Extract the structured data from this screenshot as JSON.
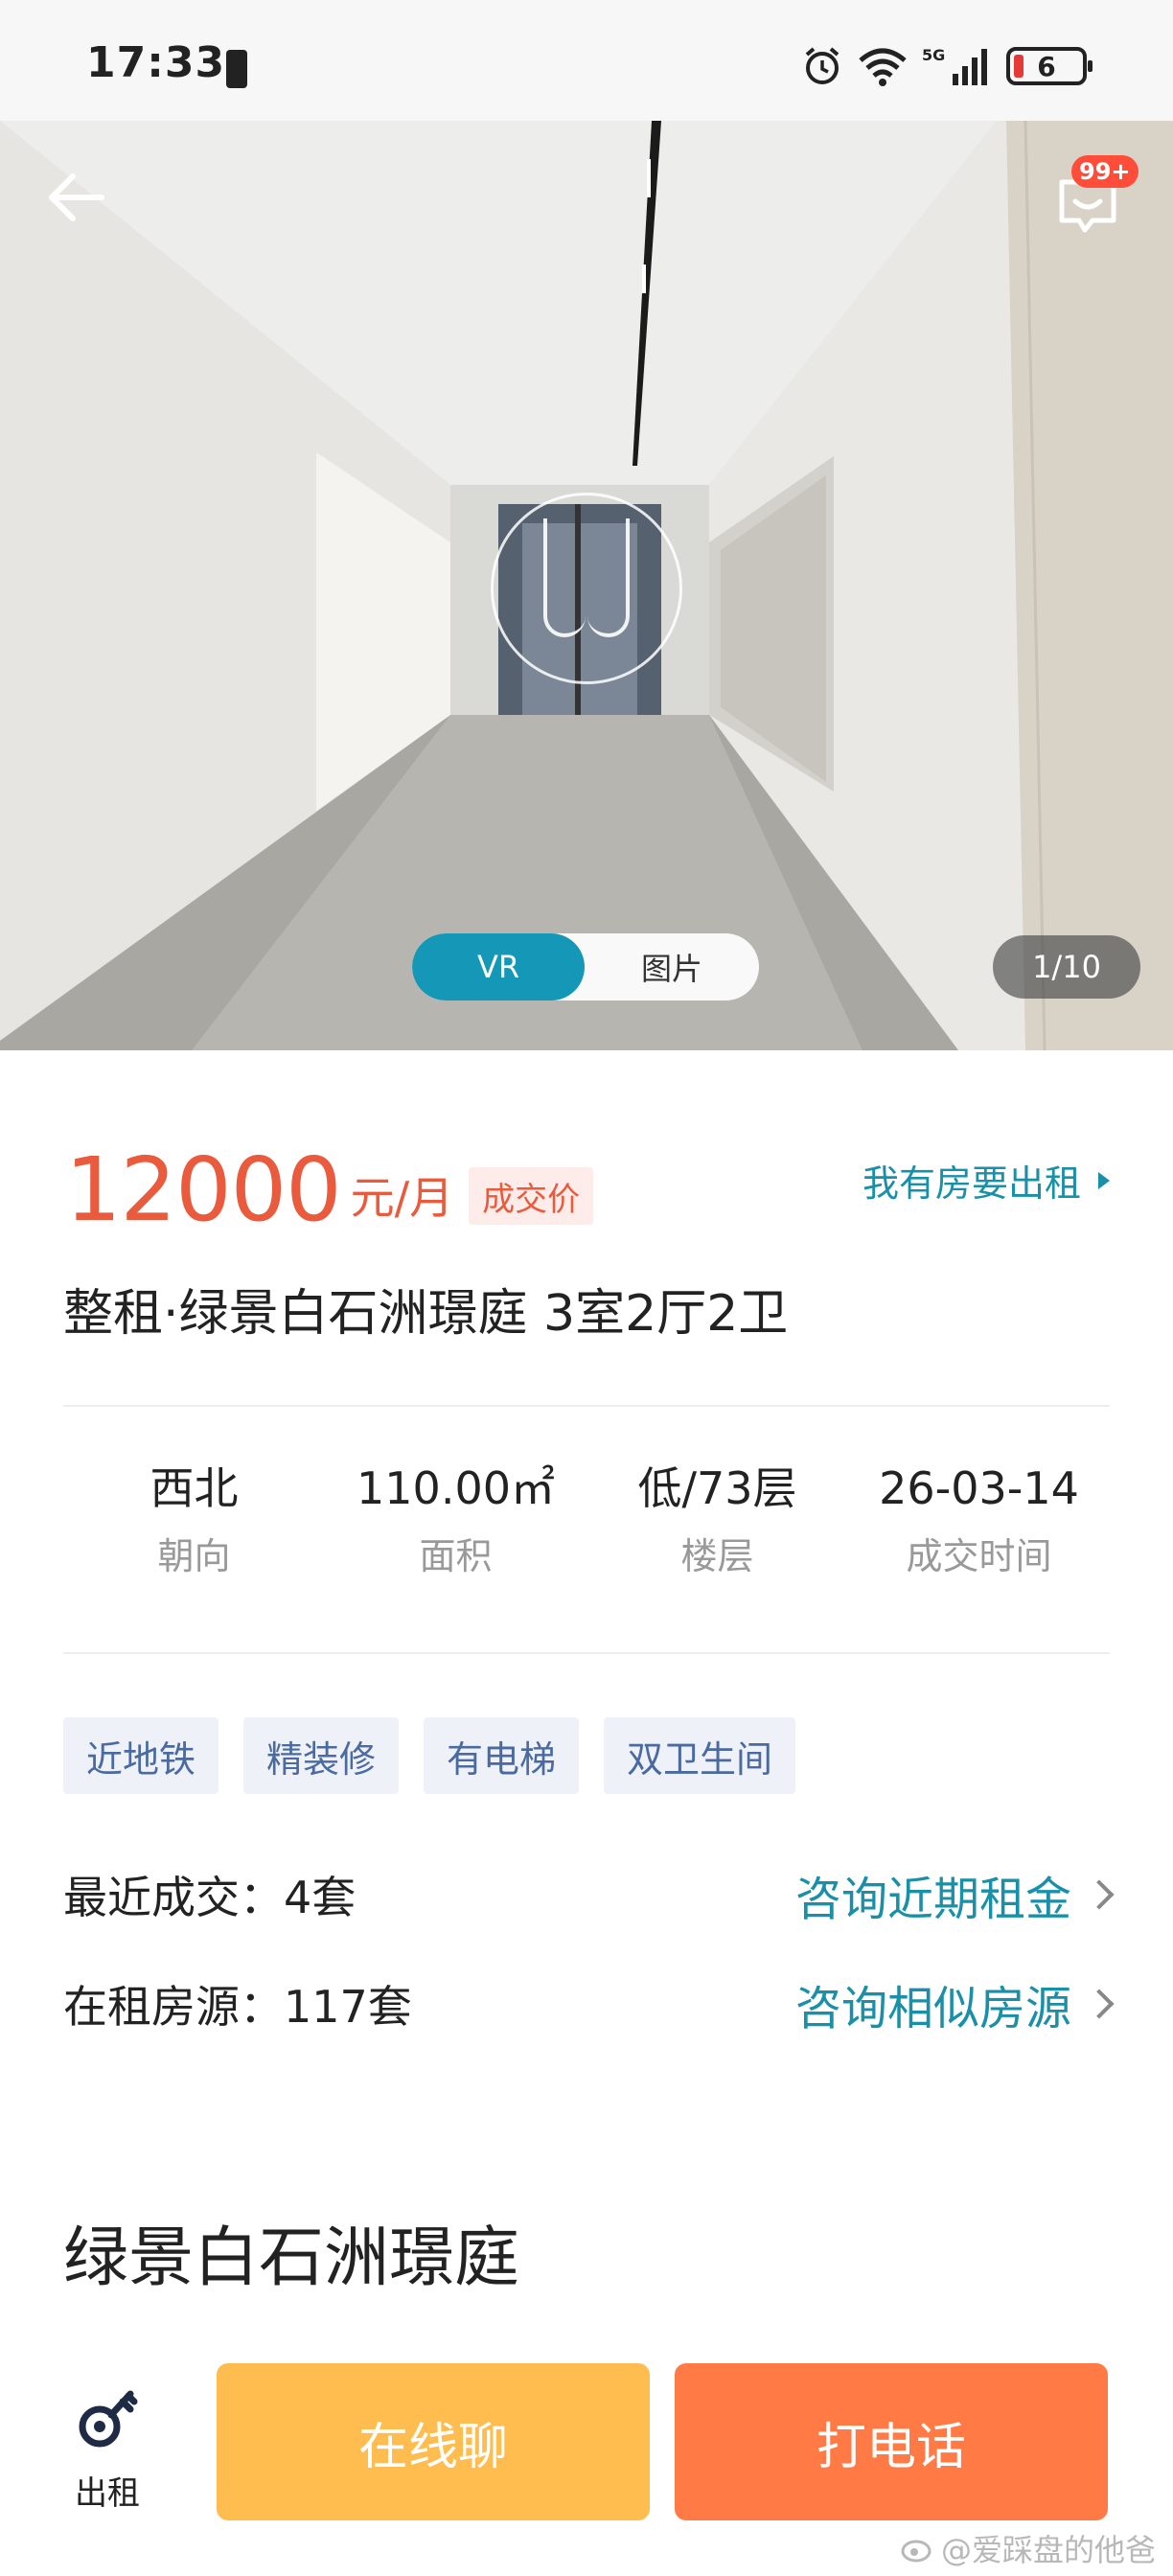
{
  "status_bar": {
    "time": "17:33",
    "battery": "6",
    "network": "5G"
  },
  "hero": {
    "badge_count": "99+",
    "toggle_vr": "VR",
    "toggle_photo": "图片",
    "counter": "1/10"
  },
  "price": {
    "amount": "12000",
    "unit": "元/月",
    "tag": "成交价",
    "owner_link": "我有房要出租"
  },
  "listing_title": "整租·绿景白石洲璟庭 3室2厅2卫",
  "stats": [
    {
      "value": "西北",
      "label": "朝向"
    },
    {
      "value": "110.00㎡",
      "label": "面积"
    },
    {
      "value": "低/73层",
      "label": "楼层"
    },
    {
      "value": "26-03-14",
      "label": "成交时间"
    }
  ],
  "tags": [
    "近地铁",
    "精装修",
    "有电梯",
    "双卫生间"
  ],
  "info_rows": [
    {
      "left": "最近成交：4套",
      "right": "咨询近期租金"
    },
    {
      "left": "在租房源：117套",
      "right": "咨询相似房源"
    }
  ],
  "community_title": "绿景白石洲璟庭",
  "bottom_bar": {
    "rent_label": "出租",
    "chat_label": "在线聊",
    "call_label": "打电话"
  },
  "watermark": "@爱踩盘的他爸",
  "colors": {
    "accent_teal": "#1598b7",
    "price_red": "#ea5a3c",
    "chat_yellow": "#ffbc4f",
    "call_orange": "#ff7a45"
  }
}
